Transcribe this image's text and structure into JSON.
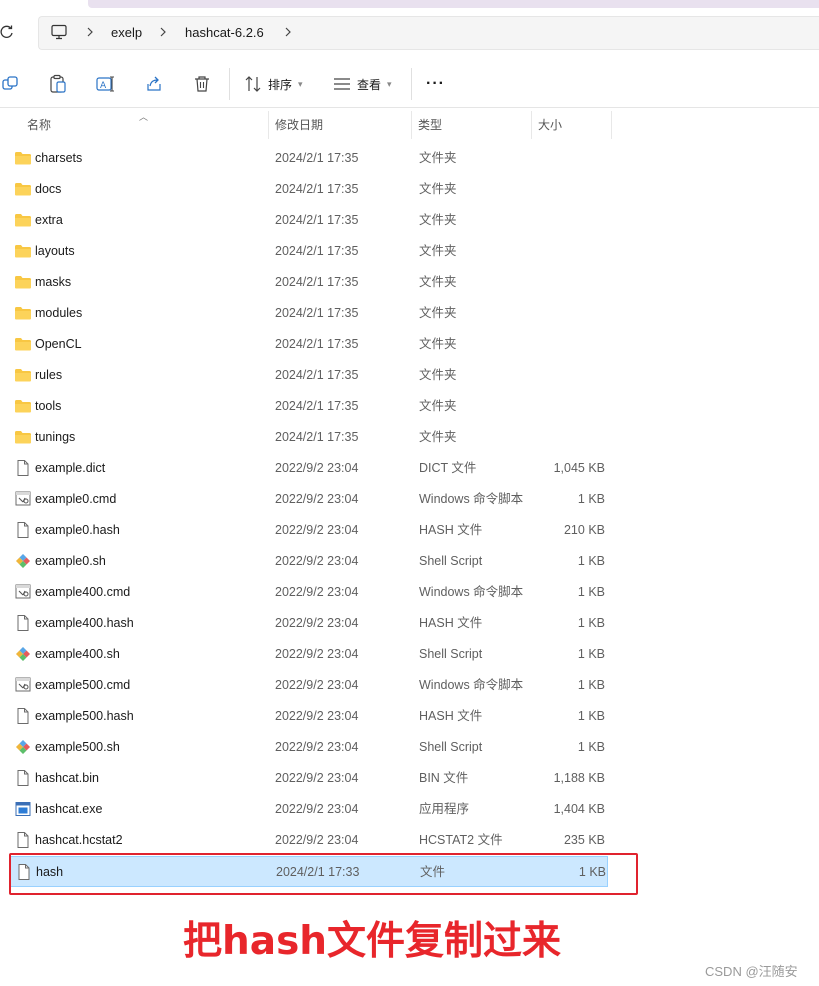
{
  "breadcrumb": {
    "items": [
      "exelp",
      "hashcat-6.2.6"
    ]
  },
  "toolbar": {
    "sort_label": "排序",
    "view_label": "查看",
    "more_label": "···"
  },
  "columns": {
    "name": "名称",
    "date": "修改日期",
    "type": "类型",
    "size": "大小"
  },
  "files": [
    {
      "name": "charsets",
      "date": "2024/2/1 17:35",
      "type": "文件夹",
      "size": "",
      "icon": "folder-icon"
    },
    {
      "name": "docs",
      "date": "2024/2/1 17:35",
      "type": "文件夹",
      "size": "",
      "icon": "folder-icon"
    },
    {
      "name": "extra",
      "date": "2024/2/1 17:35",
      "type": "文件夹",
      "size": "",
      "icon": "folder-icon"
    },
    {
      "name": "layouts",
      "date": "2024/2/1 17:35",
      "type": "文件夹",
      "size": "",
      "icon": "folder-icon"
    },
    {
      "name": "masks",
      "date": "2024/2/1 17:35",
      "type": "文件夹",
      "size": "",
      "icon": "folder-icon"
    },
    {
      "name": "modules",
      "date": "2024/2/1 17:35",
      "type": "文件夹",
      "size": "",
      "icon": "folder-icon"
    },
    {
      "name": "OpenCL",
      "date": "2024/2/1 17:35",
      "type": "文件夹",
      "size": "",
      "icon": "folder-icon"
    },
    {
      "name": "rules",
      "date": "2024/2/1 17:35",
      "type": "文件夹",
      "size": "",
      "icon": "folder-icon"
    },
    {
      "name": "tools",
      "date": "2024/2/1 17:35",
      "type": "文件夹",
      "size": "",
      "icon": "folder-icon"
    },
    {
      "name": "tunings",
      "date": "2024/2/1 17:35",
      "type": "文件夹",
      "size": "",
      "icon": "folder-icon"
    },
    {
      "name": "example.dict",
      "date": "2022/9/2 23:04",
      "type": "DICT 文件",
      "size": "1,045 KB",
      "icon": "file-icon"
    },
    {
      "name": "example0.cmd",
      "date": "2022/9/2 23:04",
      "type": "Windows 命令脚本",
      "size": "1 KB",
      "icon": "cmd-script-icon"
    },
    {
      "name": "example0.hash",
      "date": "2022/9/2 23:04",
      "type": "HASH 文件",
      "size": "210 KB",
      "icon": "file-icon"
    },
    {
      "name": "example0.sh",
      "date": "2022/9/2 23:04",
      "type": "Shell Script",
      "size": "1 KB",
      "icon": "shell-script-icon"
    },
    {
      "name": "example400.cmd",
      "date": "2022/9/2 23:04",
      "type": "Windows 命令脚本",
      "size": "1 KB",
      "icon": "cmd-script-icon"
    },
    {
      "name": "example400.hash",
      "date": "2022/9/2 23:04",
      "type": "HASH 文件",
      "size": "1 KB",
      "icon": "file-icon"
    },
    {
      "name": "example400.sh",
      "date": "2022/9/2 23:04",
      "type": "Shell Script",
      "size": "1 KB",
      "icon": "shell-script-icon"
    },
    {
      "name": "example500.cmd",
      "date": "2022/9/2 23:04",
      "type": "Windows 命令脚本",
      "size": "1 KB",
      "icon": "cmd-script-icon"
    },
    {
      "name": "example500.hash",
      "date": "2022/9/2 23:04",
      "type": "HASH 文件",
      "size": "1 KB",
      "icon": "file-icon"
    },
    {
      "name": "example500.sh",
      "date": "2022/9/2 23:04",
      "type": "Shell Script",
      "size": "1 KB",
      "icon": "shell-script-icon"
    },
    {
      "name": "hashcat.bin",
      "date": "2022/9/2 23:04",
      "type": "BIN 文件",
      "size": "1,188 KB",
      "icon": "file-icon"
    },
    {
      "name": "hashcat.exe",
      "date": "2022/9/2 23:04",
      "type": "应用程序",
      "size": "1,404 KB",
      "icon": "exe-icon"
    },
    {
      "name": "hashcat.hcstat2",
      "date": "2022/9/2 23:04",
      "type": "HCSTAT2 文件",
      "size": "235 KB",
      "icon": "file-icon"
    },
    {
      "name": "hash",
      "date": "2024/2/1 17:33",
      "type": "文件",
      "size": "1 KB",
      "icon": "file-icon",
      "selected": true
    }
  ],
  "annotation": {
    "caption": "把hash文件复制过来",
    "color": "#e8262b"
  },
  "watermark": "CSDN @汪随安",
  "colors": {
    "selection_bg": "#cce8ff",
    "selection_border": "#99d1ff",
    "folder": "#f8c743"
  }
}
